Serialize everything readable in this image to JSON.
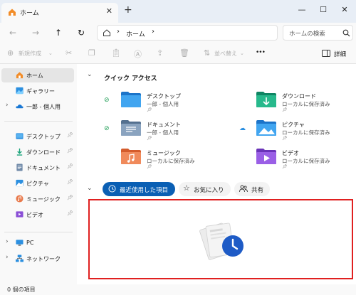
{
  "window": {
    "tab_title": "ホーム",
    "new_tab": "+",
    "close_tab": "✕",
    "minimize": "—",
    "maximize": "☐",
    "close": "✕"
  },
  "nav": {
    "back": "←",
    "forward": "→",
    "up": "↑",
    "refresh": "↻",
    "breadcrumb": [
      "ホーム"
    ],
    "search_placeholder": "ホームの検索"
  },
  "commands": {
    "new": "新規作成",
    "sort": "並べ替え",
    "more": "•••",
    "details": "詳細"
  },
  "sidebar": {
    "top": [
      {
        "label": "ホーム",
        "icon": "home-icon",
        "selected": true
      },
      {
        "label": "ギャラリー",
        "icon": "gallery-icon"
      },
      {
        "label": "一郎 - 個人用",
        "icon": "onedrive-icon",
        "expandable": true
      }
    ],
    "pinned": [
      {
        "label": "デスクトップ",
        "icon": "desktop-icon"
      },
      {
        "label": "ダウンロード",
        "icon": "download-icon"
      },
      {
        "label": "ドキュメント",
        "icon": "documents-icon"
      },
      {
        "label": "ピクチャ",
        "icon": "pictures-icon"
      },
      {
        "label": "ミュージック",
        "icon": "music-icon"
      },
      {
        "label": "ビデオ",
        "icon": "videos-icon"
      }
    ],
    "bottom": [
      {
        "label": "PC",
        "icon": "pc-icon"
      },
      {
        "label": "ネットワーク",
        "icon": "network-icon"
      }
    ]
  },
  "quick_access": {
    "heading": "クイック アクセス",
    "items": [
      {
        "name": "デスクトップ",
        "sub": "一郎 - 個人用",
        "status": "synced",
        "color": "#2b8fe0"
      },
      {
        "name": "ダウンロード",
        "sub": "ローカルに保存済み",
        "status": "",
        "color": "#1aa37a"
      },
      {
        "name": "ドキュメント",
        "sub": "一郎 - 個人用",
        "status": "synced",
        "color": "#6f89a8"
      },
      {
        "name": "ピクチャ",
        "sub": "ローカルに保存済み",
        "status": "cloud",
        "color": "#2b8fe0"
      },
      {
        "name": "ミュージック",
        "sub": "ローカルに保存済み",
        "status": "",
        "color": "#e8794b"
      },
      {
        "name": "ビデオ",
        "sub": "ローカルに保存済み",
        "status": "",
        "color": "#8a4fd6"
      }
    ]
  },
  "files_tabs": [
    {
      "label": "最近使用した項目",
      "icon": "clock-icon",
      "active": true
    },
    {
      "label": "お気に入り",
      "icon": "star-icon"
    },
    {
      "label": "共有",
      "icon": "people-icon"
    }
  ],
  "status": {
    "items": "0 個の項目"
  },
  "colors": {
    "accent": "#0a5fb4",
    "highlight_border": "#e02020"
  }
}
